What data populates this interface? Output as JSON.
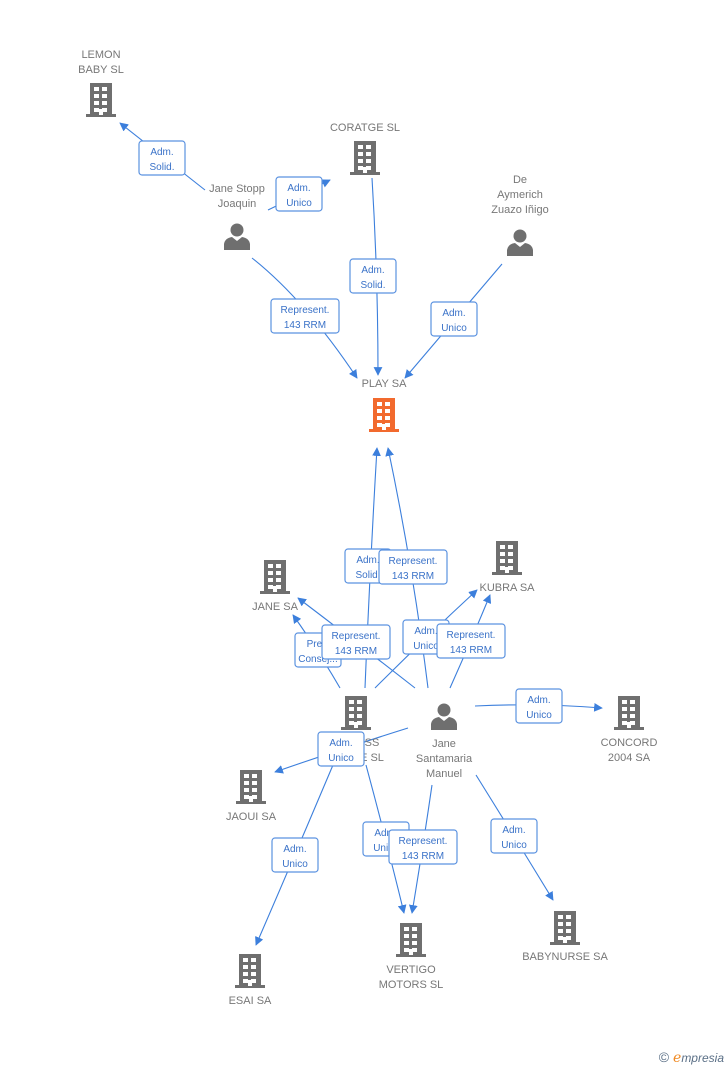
{
  "colors": {
    "edge": "#3c7fdc",
    "icon": "#6f6f6f",
    "focus": "#f26a2e",
    "label": "#777777",
    "edge_label": "#3a72c8"
  },
  "nodes": [
    {
      "id": "lemon",
      "type": "company",
      "lines": [
        "LEMON",
        "BABY SL"
      ]
    },
    {
      "id": "coratge",
      "type": "company",
      "lines": [
        "CORATGE SL"
      ]
    },
    {
      "id": "stopp",
      "type": "person",
      "lines": [
        "Jane Stopp",
        "Joaquin"
      ]
    },
    {
      "id": "aymerich",
      "type": "person",
      "lines": [
        "De",
        "Aymerich",
        "Zuazo Iñigo"
      ]
    },
    {
      "id": "play",
      "type": "company",
      "focus": true,
      "lines": [
        "PLAY SA"
      ]
    },
    {
      "id": "janesa",
      "type": "company",
      "lines": [
        "JANE SA"
      ]
    },
    {
      "id": "kubra",
      "type": "company",
      "lines": [
        "KUBRA SA"
      ]
    },
    {
      "id": "center",
      "type": "company",
      "lines": [
        "SS",
        "E  SL"
      ]
    },
    {
      "id": "santamaria",
      "type": "person",
      "lines": [
        "Jane",
        "Santamaria",
        "Manuel"
      ]
    },
    {
      "id": "concord",
      "type": "company",
      "lines": [
        "CONCORD",
        "2004 SA"
      ]
    },
    {
      "id": "jaoui",
      "type": "company",
      "lines": [
        "JAOUI SA"
      ]
    },
    {
      "id": "esai",
      "type": "company",
      "lines": [
        "ESAI SA"
      ]
    },
    {
      "id": "vertigo",
      "type": "company",
      "lines": [
        "VERTIGO",
        "MOTORS SL"
      ]
    },
    {
      "id": "babynurse",
      "type": "company",
      "lines": [
        "BABYNURSE SA"
      ]
    }
  ],
  "edges": [
    {
      "from": "stopp",
      "to": "lemon",
      "label": [
        "Adm.",
        "Solid."
      ]
    },
    {
      "from": "stopp",
      "to": "coratge",
      "label": [
        "Adm.",
        "Unico"
      ]
    },
    {
      "from": "coratge",
      "to": "play",
      "label": [
        "Adm.",
        "Solid."
      ]
    },
    {
      "from": "stopp",
      "to": "play",
      "label": [
        "Represent.",
        "143 RRM"
      ]
    },
    {
      "from": "aymerich",
      "to": "play",
      "label": [
        "Adm.",
        "Unico"
      ]
    },
    {
      "from": "center",
      "to": "play",
      "label": [
        "Adm.",
        "Solid."
      ]
    },
    {
      "from": "santamaria",
      "to": "play",
      "label": [
        "Represent.",
        "143 RRM"
      ]
    },
    {
      "from": "center",
      "to": "janesa",
      "label": [
        "Presi",
        "Consej..."
      ]
    },
    {
      "from": "santamaria",
      "to": "janesa",
      "label": [
        "Represent.",
        "143 RRM"
      ]
    },
    {
      "from": "center",
      "to": "kubra",
      "label": [
        "Adm.",
        "Unico"
      ]
    },
    {
      "from": "santamaria",
      "to": "kubra",
      "label": [
        "Represent.",
        "143 RRM"
      ]
    },
    {
      "from": "santamaria",
      "to": "concord",
      "label": [
        "Adm.",
        "Unico"
      ]
    },
    {
      "from": "santamaria",
      "to": "jaoui",
      "label": [
        "Adm.",
        "Unico"
      ]
    },
    {
      "from": "center",
      "to": "esai",
      "label": [
        "Adm.",
        "Unico"
      ]
    },
    {
      "from": "center",
      "to": "vertigo",
      "label": [
        "Adm.",
        "Unico"
      ]
    },
    {
      "from": "santamaria",
      "to": "vertigo",
      "label": [
        "Represent.",
        "143 RRM"
      ]
    },
    {
      "from": "santamaria",
      "to": "babynurse",
      "label": [
        "Adm.",
        "Unico"
      ]
    }
  ],
  "footer": {
    "copyright": "©",
    "brand_initial": "e",
    "brand_rest": "mpresia"
  }
}
